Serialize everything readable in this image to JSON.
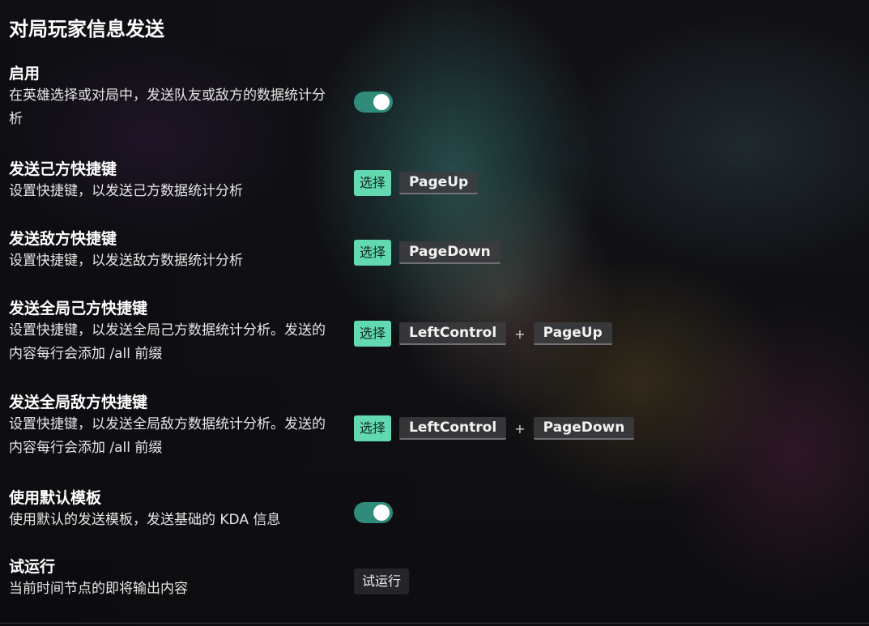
{
  "page": {
    "title": "对局玩家信息发送"
  },
  "settings": [
    {
      "title": "启用",
      "desc": "在英雄选择或对局中，发送队友或敌方的数据统计分析",
      "control": "toggle",
      "toggle_on": true
    },
    {
      "title": "发送己方快捷键",
      "desc": "设置快捷键，以发送己方数据统计分析",
      "control": "hotkey",
      "select_label": "选择",
      "keys": [
        "PageUp"
      ]
    },
    {
      "title": "发送敌方快捷键",
      "desc": "设置快捷键，以发送敌方数据统计分析",
      "control": "hotkey",
      "select_label": "选择",
      "keys": [
        "PageDown"
      ]
    },
    {
      "title": "发送全局己方快捷键",
      "desc": "设置快捷键，以发送全局己方数据统计分析。发送的内容每行会添加 /all 前缀",
      "control": "hotkey",
      "select_label": "选择",
      "keys": [
        "LeftControl",
        "PageUp"
      ],
      "separator": "+"
    },
    {
      "title": "发送全局敌方快捷键",
      "desc": "设置快捷键，以发送全局敌方数据统计分析。发送的内容每行会添加 /all 前缀",
      "control": "hotkey",
      "select_label": "选择",
      "keys": [
        "LeftControl",
        "PageDown"
      ],
      "separator": "+"
    },
    {
      "title": "使用默认模板",
      "desc": "使用默认的发送模板，发送基础的 KDA 信息",
      "control": "toggle",
      "toggle_on": true
    },
    {
      "title": "试运行",
      "desc": "当前时间节点的即将输出内容",
      "control": "button",
      "button_label": "试运行"
    }
  ],
  "colors": {
    "toggle_on": "#2f8c7a",
    "select_button": "#63d9b2",
    "key_background": "#3c3c40"
  }
}
